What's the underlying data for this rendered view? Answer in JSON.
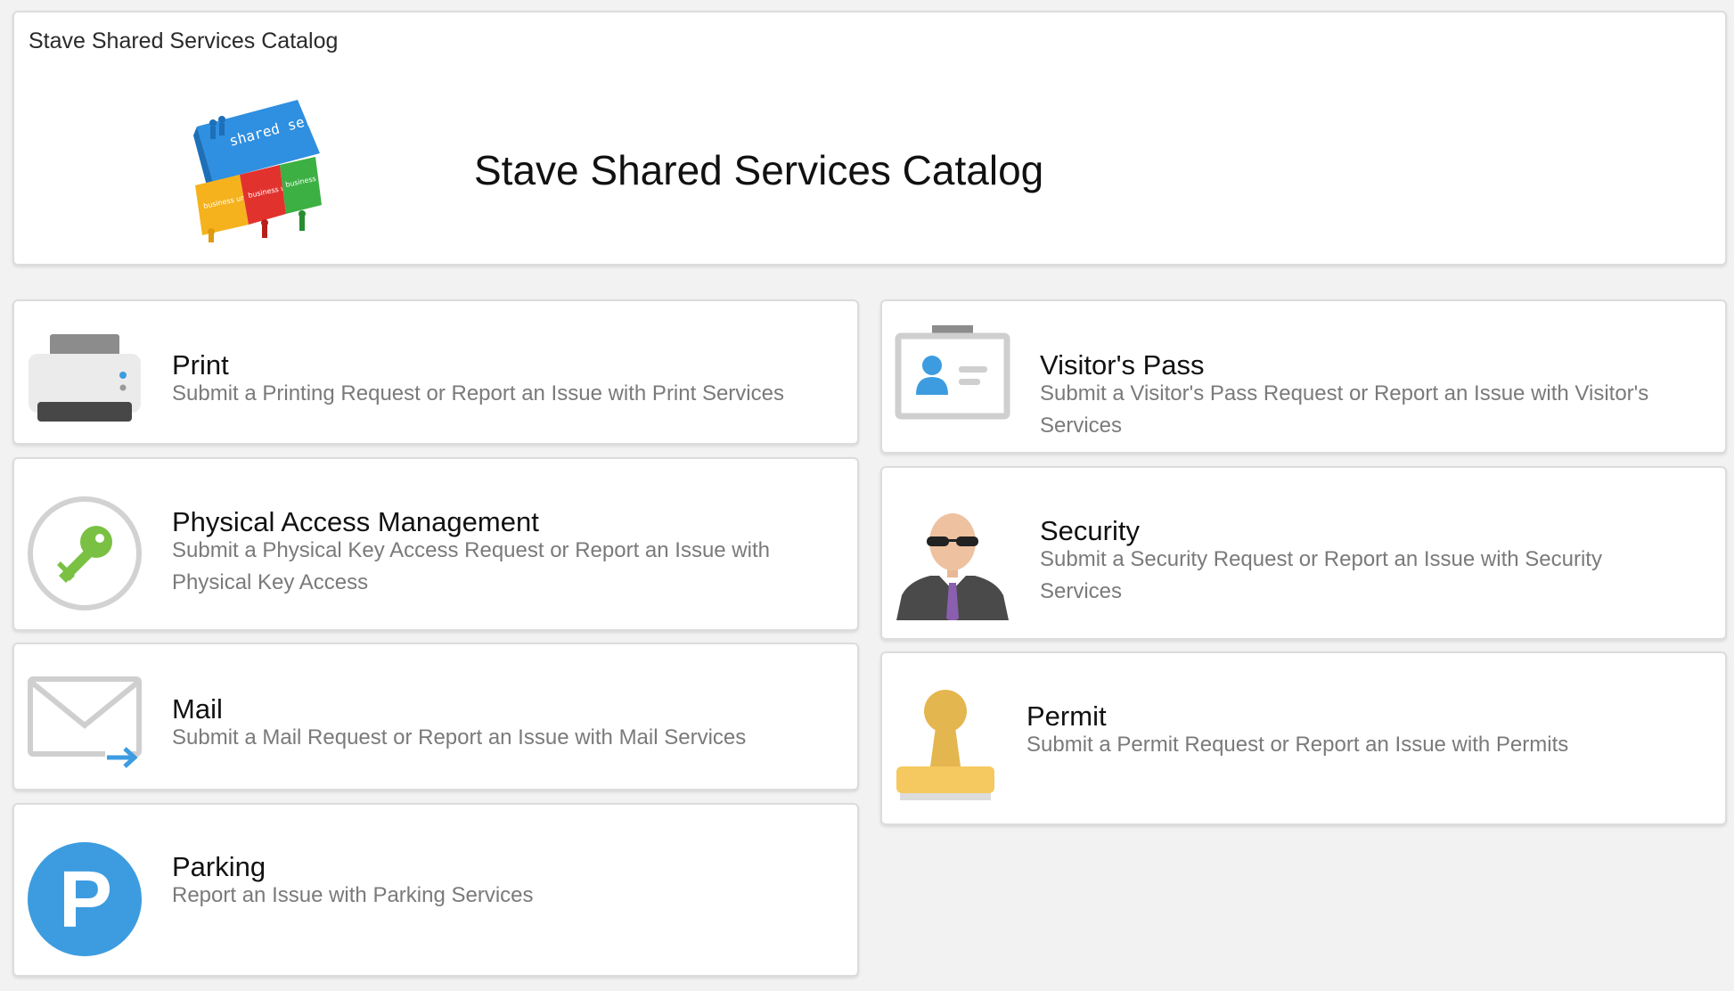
{
  "header": {
    "small_title": "Stave Shared Services Catalog",
    "big_title": "Stave Shared Services Catalog",
    "logo": {
      "icon": "shared-services-logo",
      "top_text": "shared services",
      "tiles": [
        "business unit",
        "business unit",
        "business unit"
      ]
    }
  },
  "services": {
    "print": {
      "title": "Print",
      "description": "Submit a Printing Request or Report an Issue with Print Services",
      "icon": "printer-icon"
    },
    "physical_access": {
      "title": "Physical Access Management",
      "description": "Submit a Physical Key Access Request or Report an Issue with Physical Key Access",
      "icon": "key-icon"
    },
    "mail": {
      "title": "Mail",
      "description": "Submit a Mail Request or Report an Issue with Mail Services",
      "icon": "mail-icon"
    },
    "parking": {
      "title": "Parking",
      "description": "Report an Issue with Parking Services",
      "icon": "parking-icon",
      "glyph": "P"
    },
    "visitors_pass": {
      "title": "Visitor's Pass",
      "description": "Submit a Visitor's Pass Request or Report an Issue with Visitor's Services",
      "icon": "id-badge-icon"
    },
    "security": {
      "title": "Security",
      "description": "Submit a Security Request or Report an Issue with Security Services",
      "icon": "security-guard-icon"
    },
    "permit": {
      "title": "Permit",
      "description": "Submit a Permit Request or Report an Issue with Permits",
      "icon": "stamp-icon"
    }
  },
  "colors": {
    "key_green": "#7ac143",
    "parking_blue": "#3d9ce0",
    "mail_arrow_blue": "#3d9ce0",
    "stamp_gold": "#e4b64f",
    "tie_purple": "#8a5fb0",
    "badge_blue": "#3d9ce0"
  }
}
